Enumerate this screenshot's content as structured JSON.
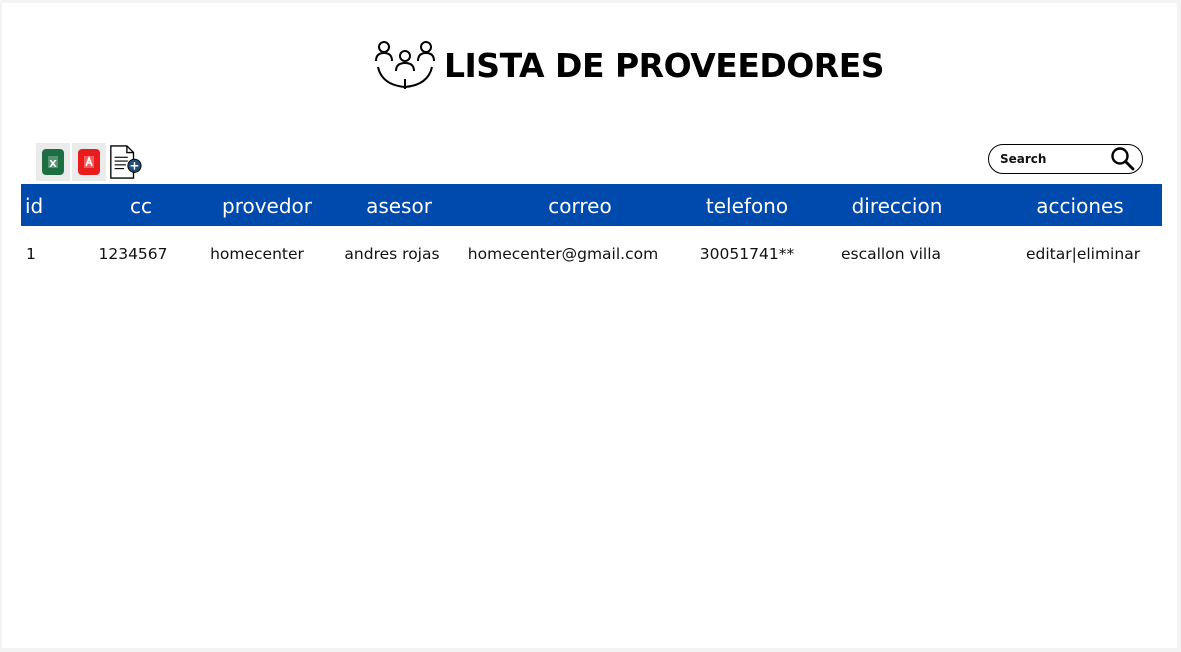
{
  "header": {
    "title": "LISTA DE PROVEEDORES",
    "icon": "people-group-icon"
  },
  "toolbar": {
    "buttons": [
      {
        "name": "excel-export-button",
        "icon": "excel-icon",
        "color": "#1d6f42",
        "glyph": "X"
      },
      {
        "name": "pdf-export-button",
        "icon": "pdf-icon",
        "color": "#e81c1c"
      },
      {
        "name": "new-document-button",
        "icon": "document-add-icon",
        "color": "#1f4e79"
      }
    ]
  },
  "search": {
    "placeholder": "Search",
    "icon": "search-icon"
  },
  "table": {
    "header_color": "#004aad",
    "columns": [
      "id",
      "cc",
      "provedor",
      "asesor",
      "correo",
      "telefono",
      "direccion",
      "acciones"
    ],
    "rows": [
      {
        "id": "1",
        "cc": "1234567",
        "provedor": "homecenter",
        "asesor": "andres rojas",
        "correo": "homecenter@gmail.com",
        "telefono": "30051741**",
        "direccion": "escallon villa",
        "acciones": {
          "edit": "editar",
          "separator": "|",
          "delete": "eliminar"
        }
      }
    ]
  }
}
